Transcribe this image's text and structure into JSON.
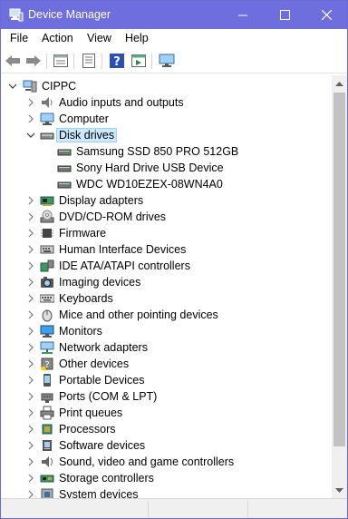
{
  "window": {
    "title": "Device Manager"
  },
  "menu": [
    "File",
    "Action",
    "View",
    "Help"
  ],
  "toolbar_icons": [
    "back-arrow-icon",
    "forward-arrow-icon",
    "properties-icon",
    "list-icon",
    "help-icon",
    "run-icon",
    "monitor-icon"
  ],
  "tree": {
    "root": "CIPPC",
    "categories": [
      {
        "label": "Audio inputs and outputs",
        "icon": "speaker-icon"
      },
      {
        "label": "Computer",
        "icon": "computer-icon"
      },
      {
        "label": "Disk drives",
        "icon": "disk-icon",
        "expanded": true,
        "selected": true,
        "children": [
          "Samsung SSD 850 PRO 512GB",
          "Sony Hard Drive USB Device",
          "WDC WD10EZEX-08WN4A0"
        ]
      },
      {
        "label": "Display adapters",
        "icon": "display-adapter-icon"
      },
      {
        "label": "DVD/CD-ROM drives",
        "icon": "dvd-icon"
      },
      {
        "label": "Firmware",
        "icon": "firmware-icon"
      },
      {
        "label": "Human Interface Devices",
        "icon": "hid-icon"
      },
      {
        "label": "IDE ATA/ATAPI controllers",
        "icon": "ide-icon"
      },
      {
        "label": "Imaging devices",
        "icon": "imaging-icon"
      },
      {
        "label": "Keyboards",
        "icon": "keyboard-icon"
      },
      {
        "label": "Mice and other pointing devices",
        "icon": "mouse-icon"
      },
      {
        "label": "Monitors",
        "icon": "monitor-icon"
      },
      {
        "label": "Network adapters",
        "icon": "network-icon"
      },
      {
        "label": "Other devices",
        "icon": "unknown-device-icon"
      },
      {
        "label": "Portable Devices",
        "icon": "portable-device-icon"
      },
      {
        "label": "Ports (COM & LPT)",
        "icon": "port-icon"
      },
      {
        "label": "Print queues",
        "icon": "printer-icon"
      },
      {
        "label": "Processors",
        "icon": "processor-icon"
      },
      {
        "label": "Software devices",
        "icon": "software-device-icon"
      },
      {
        "label": "Sound, video and game controllers",
        "icon": "sound-icon"
      },
      {
        "label": "Storage controllers",
        "icon": "storage-controller-icon"
      },
      {
        "label": "System devices",
        "icon": "system-device-icon"
      }
    ]
  },
  "colors": {
    "titlebar": "#6e6edf",
    "selection": "#cce8ff"
  }
}
